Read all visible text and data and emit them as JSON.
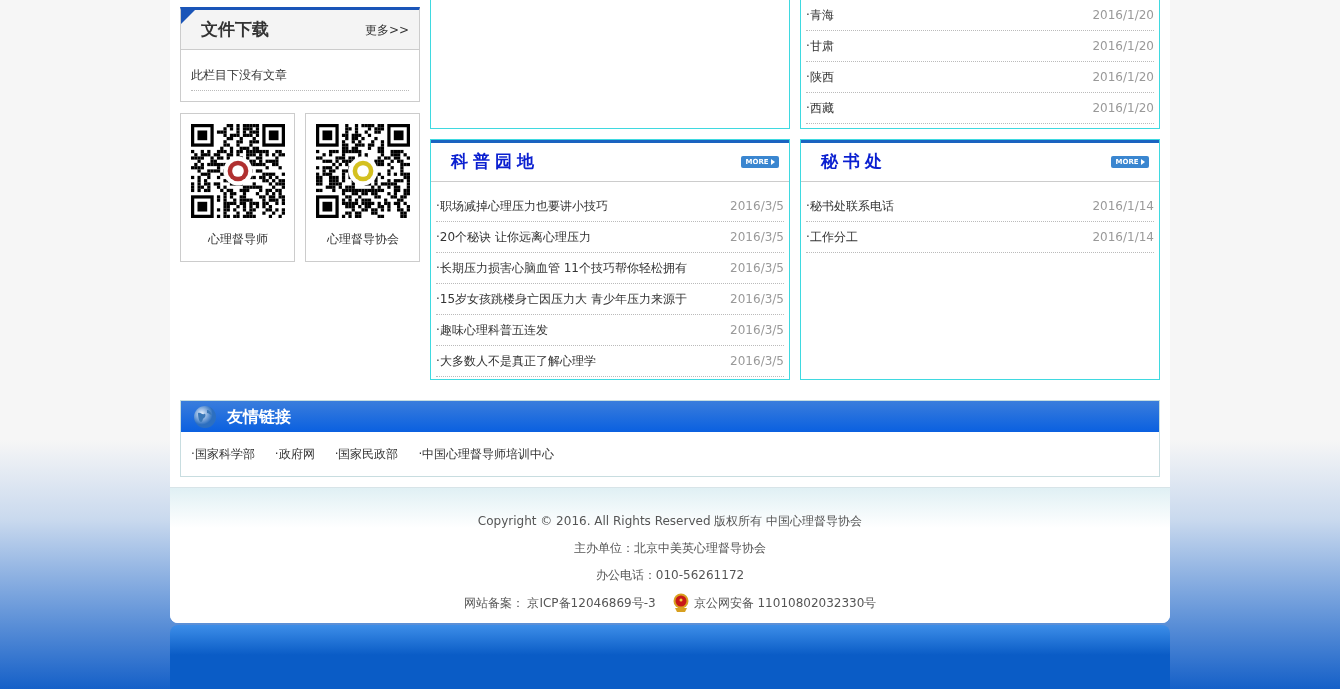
{
  "downloads": {
    "title": "文件下载",
    "more": "更多>>",
    "empty_text": "此栏目下没有文章"
  },
  "qr_codes": [
    {
      "caption": "心理督导师",
      "color": "#b03030"
    },
    {
      "caption": "心理督导协会",
      "color": "#d4c020"
    }
  ],
  "province_list": {
    "items": [
      {
        "title": "·青海",
        "date": "2016/1/20"
      },
      {
        "title": "·甘肃",
        "date": "2016/1/20"
      },
      {
        "title": "·陕西",
        "date": "2016/1/20"
      },
      {
        "title": "·西藏",
        "date": "2016/1/20"
      }
    ]
  },
  "panels": [
    {
      "title": "科普园地",
      "more": "MORE",
      "items": [
        {
          "title": "·职场减掉心理压力也要讲小技巧",
          "date": "2016/3/5"
        },
        {
          "title": "·20个秘诀 让你远离心理压力",
          "date": "2016/3/5"
        },
        {
          "title": "·长期压力损害心脑血管 11个技巧帮你轻松拥有",
          "date": "2016/3/5"
        },
        {
          "title": "·15岁女孩跳楼身亡因压力大 青少年压力来源于",
          "date": "2016/3/5"
        },
        {
          "title": "·趣味心理科普五连发",
          "date": "2016/3/5"
        },
        {
          "title": "·大多数人不是真正了解心理学",
          "date": "2016/3/5"
        }
      ]
    },
    {
      "title": "秘书处",
      "more": "MORE",
      "items": [
        {
          "title": "·秘书处联系电话",
          "date": "2016/1/14"
        },
        {
          "title": "·工作分工",
          "date": "2016/1/14"
        }
      ]
    }
  ],
  "friend_links": {
    "title": "友情链接",
    "links": [
      "·国家科学部",
      "·政府网",
      "·国家民政部",
      "·中国心理督导师培训中心"
    ]
  },
  "footer": {
    "copyright": "Copyright © 2016. All Rights Reserved 版权所有 中国心理督导协会",
    "sponsor": "主办单位：北京中美英心理督导协会",
    "phone": "办公电话：010-56261172",
    "icp": "网站备案： 京ICP备12046869号-3",
    "police": "京公网安备 11010802032330号"
  }
}
